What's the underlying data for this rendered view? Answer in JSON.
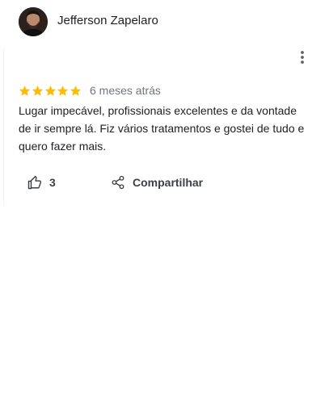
{
  "review": {
    "author": {
      "name": "Jefferson Zapelaro"
    },
    "rating": {
      "stars": 5,
      "max": 5,
      "star_color": "#fbbc04"
    },
    "date": "6 meses atrás",
    "text": "Lugar impecável, profissionais excelentes e da vontade de ir sempre lá. Fiz vários tratamentos e gostei de tudo e quero fazer mais.",
    "actions": {
      "like_count": "3",
      "share_label": "Compartilhar"
    },
    "icons": {
      "more": "more-vert-icon",
      "like": "thumb-up-icon",
      "share": "share-icon"
    }
  }
}
